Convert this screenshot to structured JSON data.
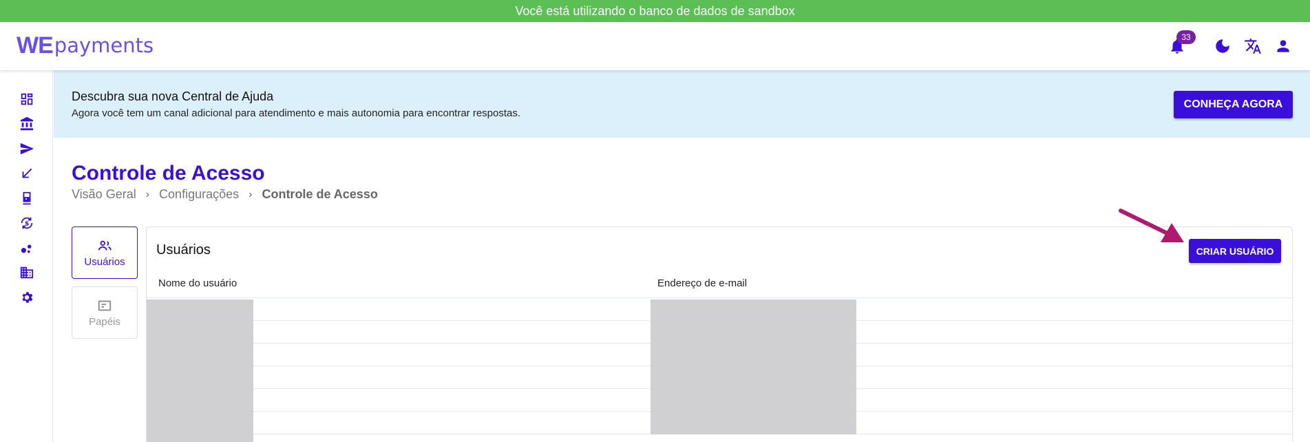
{
  "sandbox_notice": "Você está utilizando o banco de dados de sandbox",
  "brand": {
    "logo_we": "WE",
    "logo_payments": "payments",
    "accent": "#3a0fdc",
    "logo_color": "#6a4fe8"
  },
  "header": {
    "notifications": {
      "icon": "bell-icon",
      "count": "33"
    },
    "icons": [
      "bell-icon",
      "moon-icon",
      "translate-icon",
      "user-icon"
    ]
  },
  "sidebar": {
    "items": [
      {
        "icon": "dashboard-icon"
      },
      {
        "icon": "bank-icon"
      },
      {
        "icon": "send-icon"
      },
      {
        "icon": "receive-arrow-icon"
      },
      {
        "icon": "pos-terminal-icon"
      },
      {
        "icon": "currency-exchange-icon"
      },
      {
        "icon": "bubbles-icon"
      },
      {
        "icon": "building-icon"
      },
      {
        "icon": "gear-icon"
      }
    ]
  },
  "banner": {
    "title": "Descubra sua nova Central de Ajuda",
    "text": "Agora você tem um canal adicional para atendimento e mais autonomia para encontrar respostas.",
    "button_label": "CONHEÇA AGORA"
  },
  "page": {
    "title": "Controle de Acesso",
    "breadcrumb": [
      "Visão Geral",
      "Configurações",
      "Controle de Acesso"
    ]
  },
  "tabs": [
    {
      "label": "Usuários",
      "icon": "users-icon",
      "active": true
    },
    {
      "label": "Papéis",
      "icon": "id-card-icon",
      "active": false
    }
  ],
  "users_panel": {
    "title": "Usuários",
    "create_button": "CRIAR USUÁRIO",
    "columns": [
      "Nome do usuário",
      "Endereço de e-mail"
    ]
  }
}
